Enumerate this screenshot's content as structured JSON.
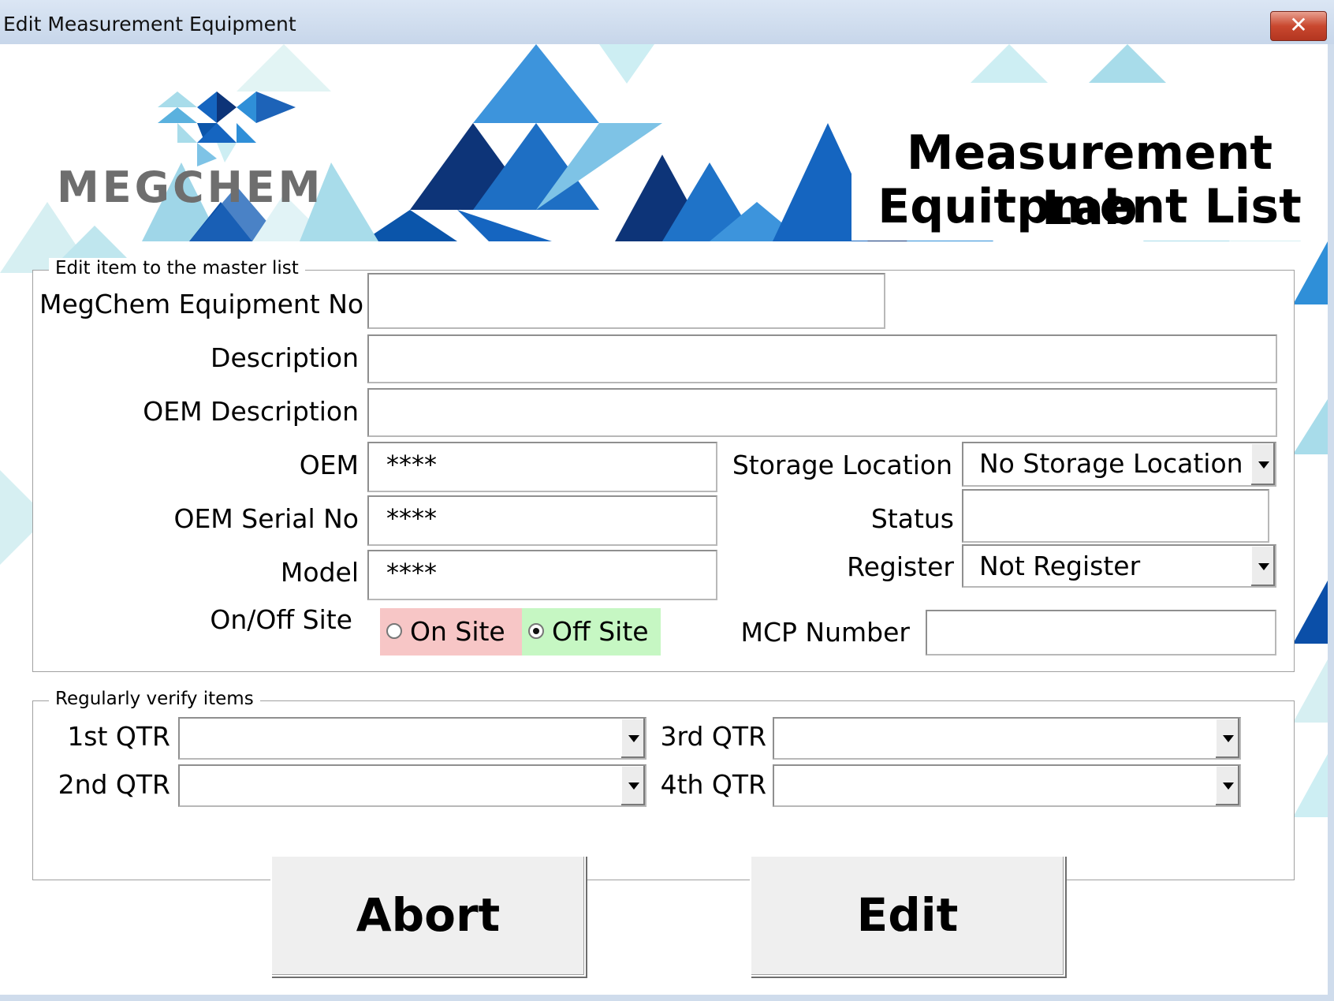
{
  "window": {
    "title": "Edit Measurement Equipment",
    "close_label": "✕"
  },
  "header": {
    "brand": "MEGCHEM",
    "title_line1": "Measurement Lab",
    "title_line2": "Equitpment List"
  },
  "master": {
    "caption": "Edit item to the master list",
    "equipment_no": {
      "label": "MegChem Equipment No",
      "value": ""
    },
    "description": {
      "label": "Description",
      "value": ""
    },
    "oem_description": {
      "label": "OEM Description",
      "value": ""
    },
    "oem": {
      "label": "OEM",
      "value": "****"
    },
    "oem_serial": {
      "label": "OEM Serial No",
      "value": "****"
    },
    "model": {
      "label": "Model",
      "value": "****"
    },
    "site": {
      "label": "On/Off Site",
      "on_label": "On Site",
      "off_label": "Off Site",
      "selected": "Off Site",
      "on_color": "#f7c6c6",
      "off_color": "#c6f7c3"
    },
    "storage": {
      "label": "Storage Location",
      "value": "No Storage Location"
    },
    "status": {
      "label": "Status",
      "value": ""
    },
    "register": {
      "label": "Register",
      "value": "Not Register"
    },
    "mcp": {
      "label": "MCP Number",
      "value": ""
    }
  },
  "verify": {
    "caption": "Regularly verify items",
    "q1": {
      "label": "1st QTR",
      "value": ""
    },
    "q2": {
      "label": "2nd QTR",
      "value": ""
    },
    "q3": {
      "label": "3rd QTR",
      "value": ""
    },
    "q4": {
      "label": "4th QTR",
      "value": ""
    }
  },
  "actions": {
    "abort_label": "Abort",
    "edit_label": "Edit"
  },
  "colors": {
    "dark_blue": "#0a2a6b",
    "mid_blue": "#1565c0",
    "blue": "#2f8fd8",
    "light_blue": "#a8dcea",
    "pale_blue": "#d6eff2"
  }
}
